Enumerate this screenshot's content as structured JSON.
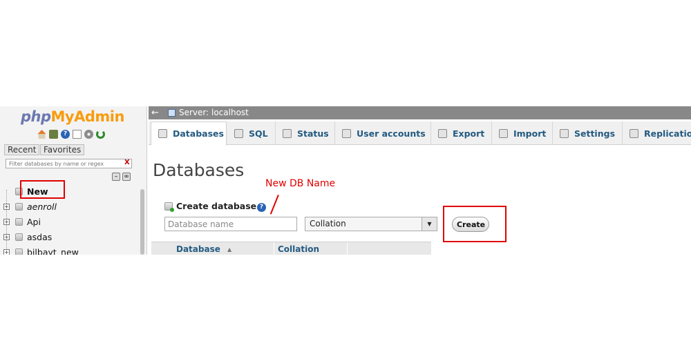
{
  "sidebar": {
    "logo_php": "php",
    "logo_myadmin": "MyAdmin",
    "icons": [
      "home-icon",
      "exit-icon",
      "help-icon",
      "docs-icon",
      "settings-icon",
      "reload-icon"
    ],
    "tabs": [
      "Recent",
      "Favorites"
    ],
    "filter_placeholder": "Filter databases by name or regex",
    "filter_clear": "X",
    "tree": [
      {
        "label": "New"
      },
      {
        "label": "aenroll"
      },
      {
        "label": "Api"
      },
      {
        "label": "asdas"
      },
      {
        "label": "bilbayt_new"
      }
    ]
  },
  "header": {
    "back": "←",
    "server": "Server: localhost"
  },
  "tabs": [
    {
      "label": "Databases",
      "icon": "database-icon"
    },
    {
      "label": "SQL",
      "icon": "sql-icon"
    },
    {
      "label": "Status",
      "icon": "status-icon"
    },
    {
      "label": "User accounts",
      "icon": "users-icon"
    },
    {
      "label": "Export",
      "icon": "export-icon"
    },
    {
      "label": "Import",
      "icon": "import-icon"
    },
    {
      "label": "Settings",
      "icon": "settings-icon"
    },
    {
      "label": "Replication",
      "icon": "replication-icon"
    }
  ],
  "main": {
    "title": "Databases",
    "annotation": "New DB Name",
    "create_heading": "Create database",
    "help": "?",
    "name_placeholder": "Database name",
    "collation": "Collation",
    "caret": "▼",
    "create_button": "Create",
    "table_headers": [
      "Database",
      "Collation"
    ],
    "sort_indicator": "▲"
  },
  "colors": {
    "accent": "#235a81",
    "highlight_box": "#e00000",
    "server_bar": "#888888"
  }
}
